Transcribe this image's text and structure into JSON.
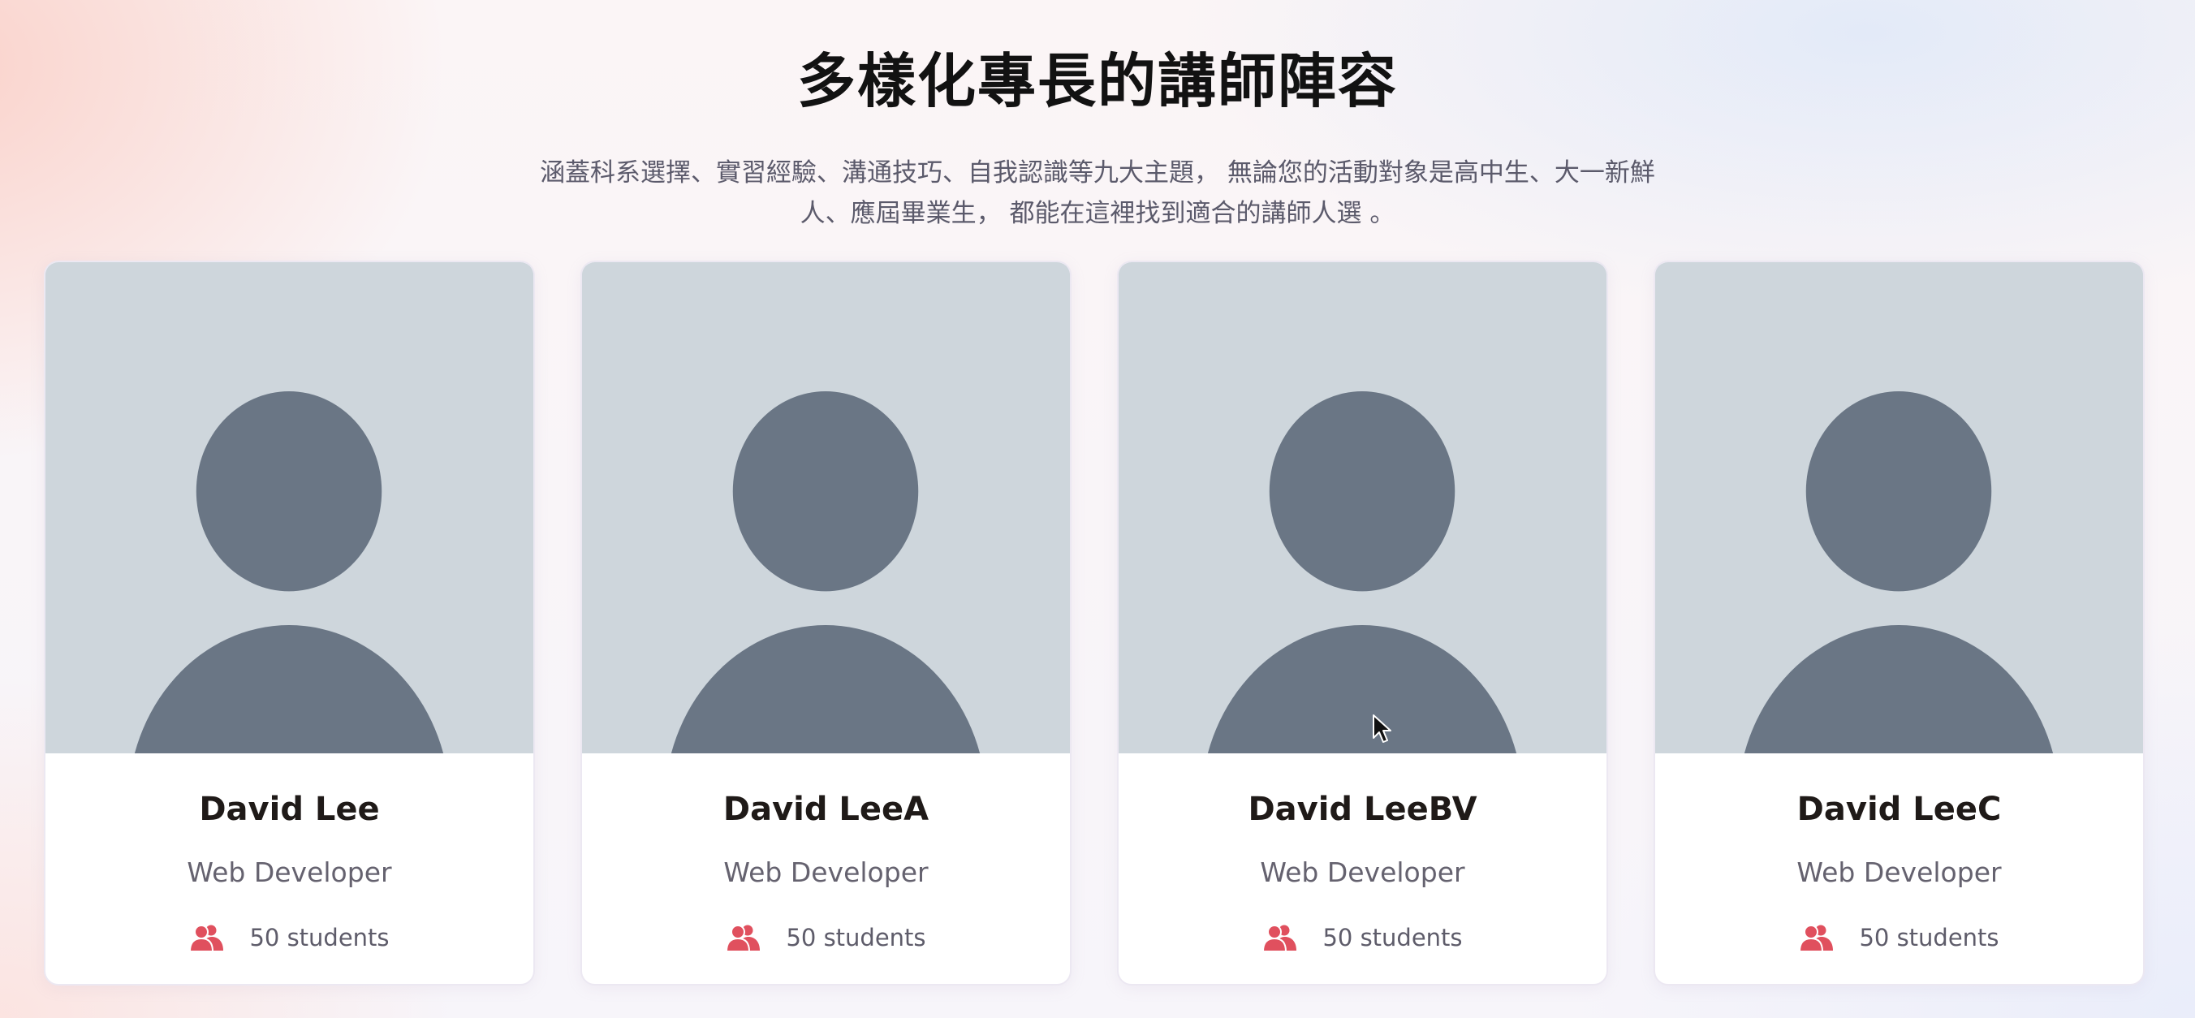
{
  "section": {
    "title": "多樣化專長的講師陣容",
    "description": "涵蓋科系選擇、實習經驗、溝通技巧、自我認識等九大主題， 無論您的活動對象是高中生、大一新鮮人、應屆畢業生， 都能在這裡找到適合的講師人選 。"
  },
  "colors": {
    "avatar_background": "#ced6dc",
    "avatar_silhouette": "#6a7685",
    "users_icon": "#e0505e"
  },
  "instructors": [
    {
      "name": "David Lee",
      "role": "Web Developer",
      "students": "50 students",
      "icon": "users-icon"
    },
    {
      "name": "David LeeA",
      "role": "Web Developer",
      "students": "50 students",
      "icon": "users-icon"
    },
    {
      "name": "David LeeBV",
      "role": "Web Developer",
      "students": "50 students",
      "icon": "users-icon"
    },
    {
      "name": "David LeeC",
      "role": "Web Developer",
      "students": "50 students",
      "icon": "users-icon"
    }
  ]
}
